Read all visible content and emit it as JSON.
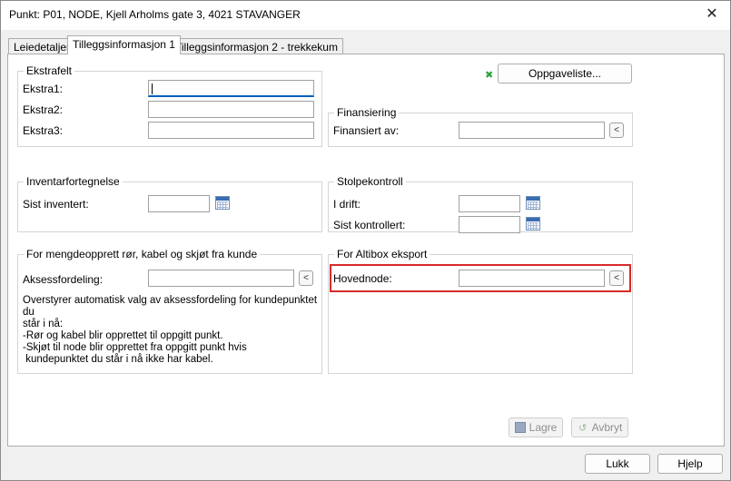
{
  "window": {
    "title": "Punkt: P01, NODE, Kjell Arholms gate 3, 4021 STAVANGER",
    "close_glyph": "✕"
  },
  "tabs": [
    {
      "label": "Leiedetaljer"
    },
    {
      "label": "Tilleggsinformasjon 1"
    },
    {
      "label": "Tilleggsinformasjon 2 - trekkekum"
    }
  ],
  "ekstrafelt": {
    "title": "Ekstrafelt",
    "fields": [
      {
        "label": "Ekstra1:",
        "value": ""
      },
      {
        "label": "Ekstra2:",
        "value": ""
      },
      {
        "label": "Ekstra3:",
        "value": ""
      }
    ]
  },
  "oppgaveliste": {
    "label": "Oppgaveliste...",
    "icon": "x-icon"
  },
  "finansiering": {
    "title": "Finansiering",
    "label": "Finansiert av:",
    "value": "",
    "lookup": "<"
  },
  "inventar": {
    "title": "Inventarfortegnelse",
    "label": "Sist inventert:",
    "value": "",
    "icon": "calendar-icon"
  },
  "stolpekontroll": {
    "title": "Stolpekontroll",
    "fields": [
      {
        "label": "I drift:",
        "value": ""
      },
      {
        "label": "Sist kontrollert:",
        "value": ""
      }
    ]
  },
  "mengde": {
    "title": "For mengdeopprett rør, kabel og skjøt fra kunde",
    "label": "Aksessfordeling:",
    "value": "",
    "lookup": "<",
    "description": [
      "Overstyrer automatisk valg av aksessfordeling for kundepunktet du",
      "står i nå:",
      "-Rør og kabel blir opprettet til oppgitt punkt.",
      "-Skjøt til node blir opprettet fra oppgitt punkt hvis",
      " kundepunktet du står i nå ikke har kabel."
    ]
  },
  "altibox": {
    "title": "For Altibox eksport",
    "label": "Hovednode:",
    "value": "",
    "lookup": "<",
    "highlight_color": "#d62a2a"
  },
  "actions": {
    "save": "Lagre",
    "cancel": "Avbryt"
  },
  "footer": {
    "close": "Lukk",
    "help": "Hjelp"
  }
}
